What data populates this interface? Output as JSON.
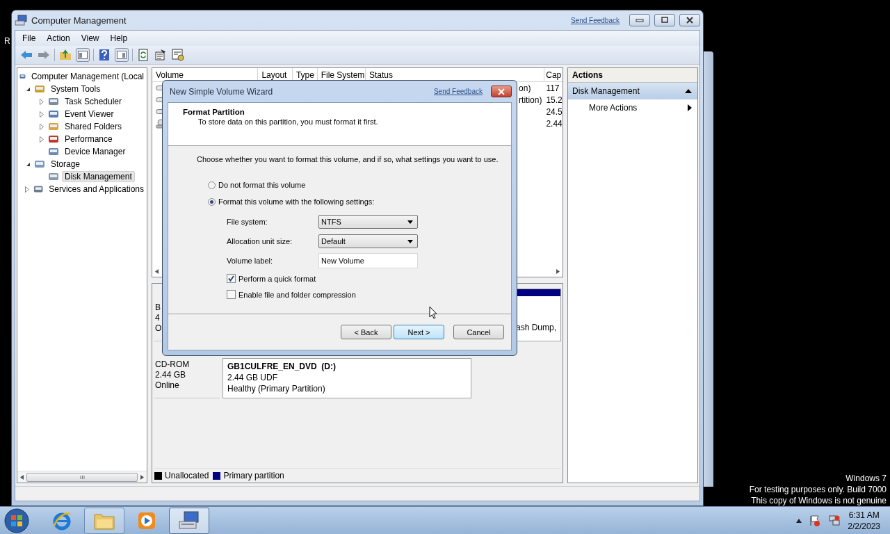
{
  "desktop": {
    "icon_label": "R",
    "watermark": [
      "Windows 7",
      "For testing purposes only. Build 7000",
      "This copy of Windows is not genuine"
    ]
  },
  "window": {
    "title": "Computer Management",
    "feedback_link": "Send Feedback"
  },
  "menu": [
    "File",
    "Action",
    "View",
    "Help"
  ],
  "tree": [
    {
      "label": "Computer Management (Local",
      "selected": false,
      "children": [
        {
          "label": "System Tools",
          "expanded": true,
          "selected": false,
          "children": [
            {
              "label": "Task Scheduler",
              "expanded": false,
              "selected": false
            },
            {
              "label": "Event Viewer",
              "expanded": false,
              "selected": false
            },
            {
              "label": "Shared Folders",
              "expanded": false,
              "selected": false
            },
            {
              "label": "Performance",
              "expanded": false,
              "selected": false
            },
            {
              "label": "Device Manager",
              "selected": false
            }
          ]
        },
        {
          "label": "Storage",
          "expanded": true,
          "selected": false,
          "children": [
            {
              "label": "Disk Management",
              "selected": true
            }
          ]
        },
        {
          "label": "Services and Applications",
          "expanded": false,
          "selected": false
        }
      ]
    }
  ],
  "volumes": {
    "columns": [
      "Volume",
      "Layout",
      "Type",
      "File System",
      "Status",
      "Cap"
    ],
    "rows": [
      {
        "kind": "disk",
        "status": "on)",
        "capacity": "117"
      },
      {
        "kind": "disk",
        "status": "rtition)",
        "capacity": "15.2"
      },
      {
        "kind": "disk",
        "capacity": "24.5"
      },
      {
        "kind": "cdrom",
        "capacity": "2.44"
      }
    ]
  },
  "disks": [
    {
      "kind": "disk",
      "label": [
        "B",
        "4",
        "O"
      ],
      "partition": {
        "lines": [
          "ash Dump,"
        ],
        "color": "#000080"
      }
    },
    {
      "kind": "cdrom",
      "label": [
        "CD-ROM",
        "2.44 GB",
        "Online"
      ],
      "partition": {
        "name": "GB1CULFRE_EN_DVD  (D:)",
        "lines": [
          "2.44 GB UDF",
          "Healthy (Primary Partition)"
        ]
      }
    }
  ],
  "legend": [
    {
      "label": "Unallocated",
      "color": "#000000"
    },
    {
      "label": "Primary partition",
      "color": "#000080"
    }
  ],
  "actions": {
    "title": "Actions",
    "sections": [
      {
        "label": "Disk Management",
        "expanded": true,
        "items": [
          "More Actions"
        ]
      }
    ]
  },
  "dialog": {
    "title": "New Simple Volume Wizard",
    "feedback_link": "Send Feedback",
    "heading": "Format Partition",
    "subheading": "To store data on this partition, you must format it first.",
    "instruction": "Choose whether you want to format this volume, and if so, what settings you want to use.",
    "options": [
      {
        "label": "Do not format this volume",
        "selected": false
      },
      {
        "label": "Format this volume with the following settings:",
        "selected": true
      }
    ],
    "fields": [
      {
        "kind": "select",
        "label": "File system:",
        "value": "NTFS"
      },
      {
        "kind": "select",
        "label": "Allocation unit size:",
        "value": "Default"
      },
      {
        "kind": "text",
        "label": "Volume label:",
        "value": "New Volume"
      }
    ],
    "checks": [
      {
        "label": "Perform a quick format",
        "checked": true
      },
      {
        "label": "Enable file and folder compression",
        "checked": false
      }
    ],
    "buttons": [
      {
        "label": "< Back",
        "focused": false
      },
      {
        "label": "Next >",
        "focused": true
      },
      {
        "label": "Cancel",
        "focused": false
      }
    ]
  },
  "taskbar": {
    "apps": [
      {
        "kind": "browser",
        "running": false,
        "active": false
      },
      {
        "kind": "folder",
        "running": true,
        "active": false
      },
      {
        "kind": "media",
        "running": false,
        "active": false
      },
      {
        "kind": "computer",
        "running": true,
        "active": true
      }
    ],
    "time": "6:31 AM",
    "date": "2/2/2023"
  }
}
